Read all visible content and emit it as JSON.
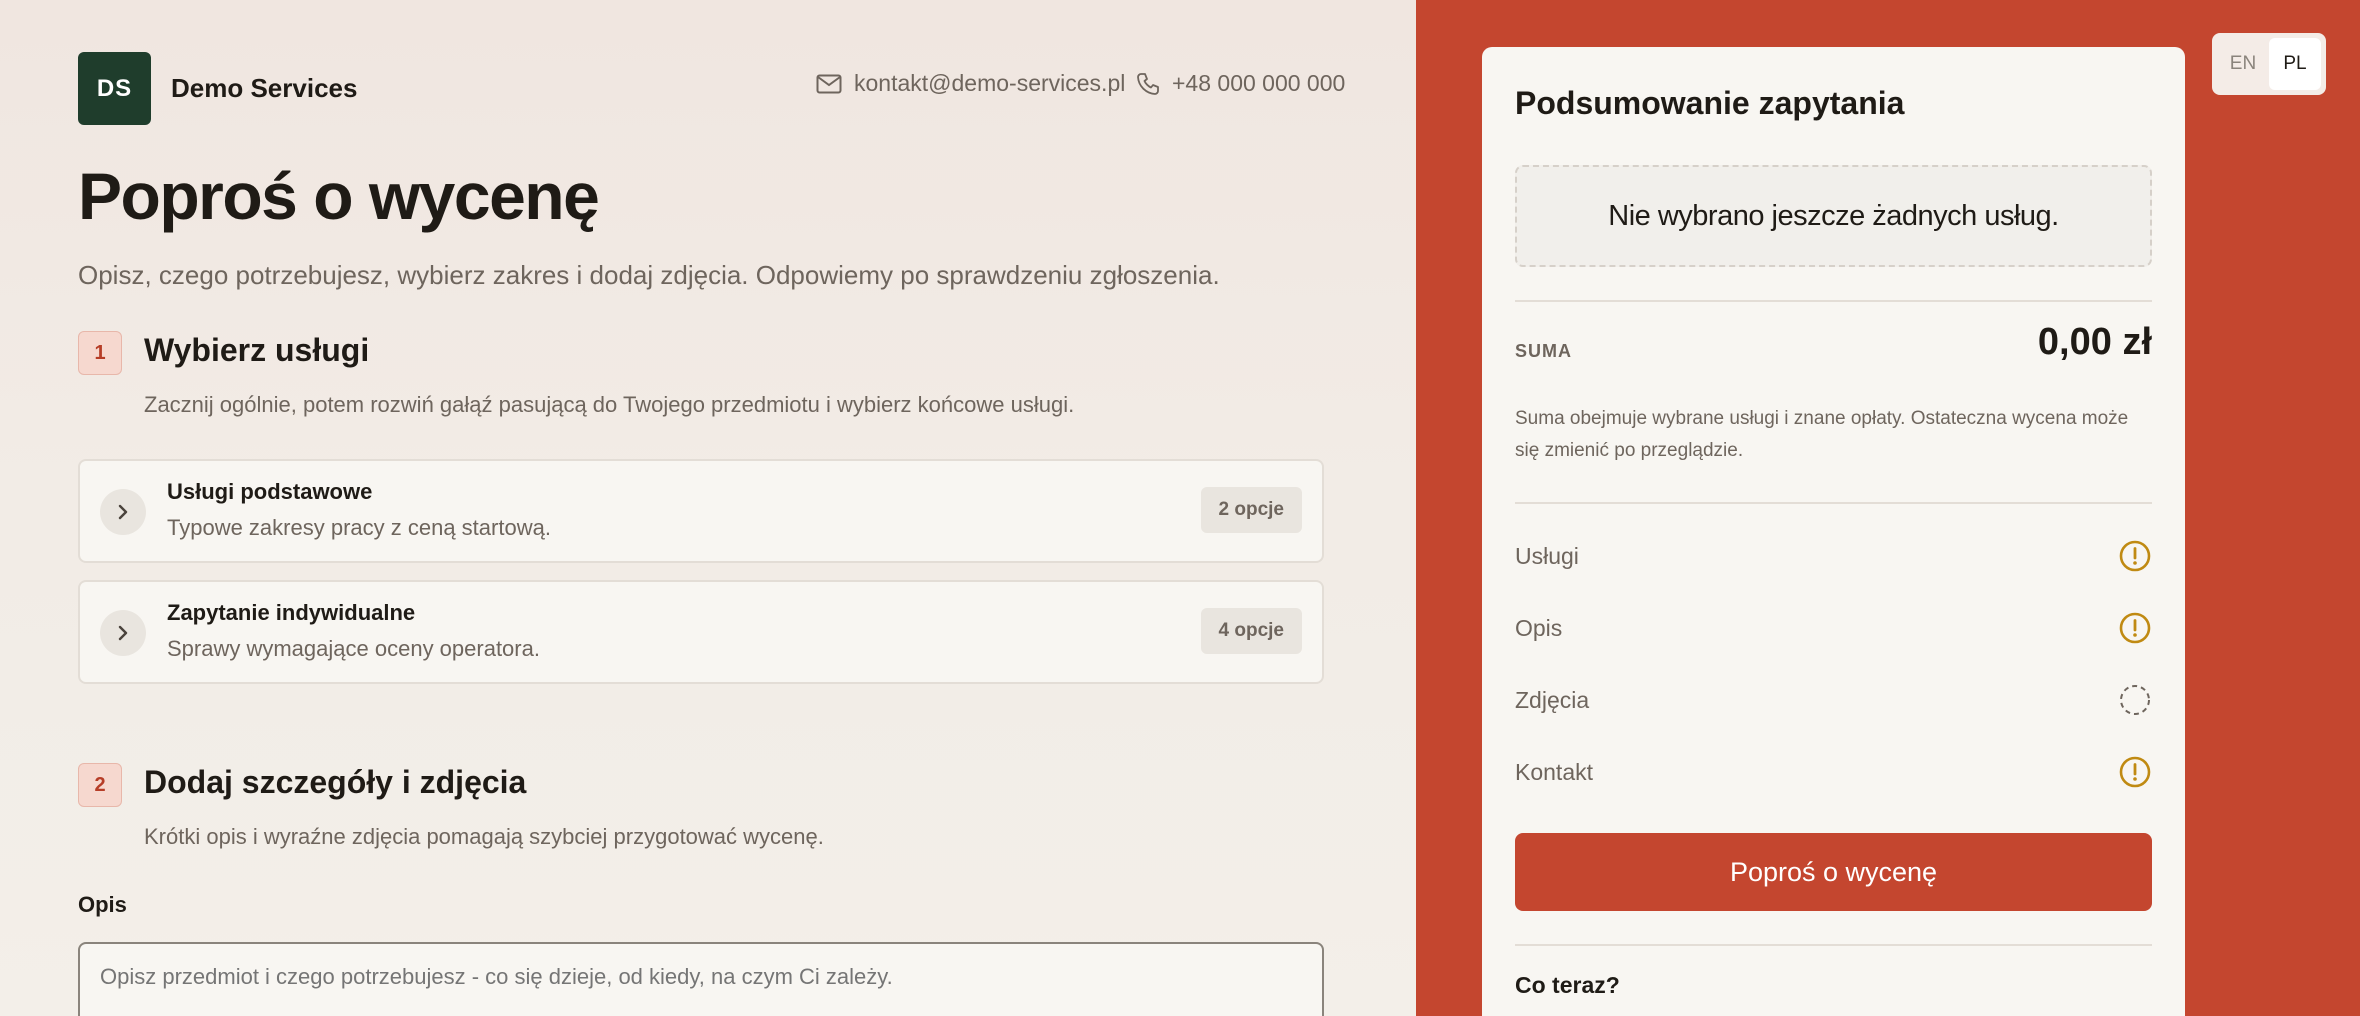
{
  "header": {
    "logo_text": "DS",
    "brand_name": "Demo Services",
    "email": "kontakt@demo-services.pl",
    "phone": "+48 000 000 000"
  },
  "page": {
    "title": "Poproś o wycenę",
    "lead": "Opisz, czego potrzebujesz, wybierz zakres i dodaj zdjęcia. Odpowiemy po sprawdzeniu zgłoszenia."
  },
  "step1": {
    "number": "1",
    "title": "Wybierz usługi",
    "subtitle": "Zacznij ogólnie, potem rozwiń gałąź pasującą do Twojego przedmiotu i wybierz końcowe usługi.",
    "cards": [
      {
        "title": "Usługi podstawowe",
        "subtitle": "Typowe zakresy pracy z ceną startową.",
        "badge": "2 opcje"
      },
      {
        "title": "Zapytanie indywidualne",
        "subtitle": "Sprawy wymagające oceny operatora.",
        "badge": "4 opcje"
      }
    ]
  },
  "step2": {
    "number": "2",
    "title": "Dodaj szczegóły i zdjęcia",
    "subtitle": "Krótki opis i wyraźne zdjęcia pomagają szybciej przygotować wycenę.",
    "description_label": "Opis",
    "description_placeholder": "Opisz przedmiot i czego potrzebujesz - co się dzieje, od kiedy, na czym Ci zależy."
  },
  "lang": {
    "options": [
      "EN",
      "PL"
    ],
    "active": "PL"
  },
  "summary": {
    "title": "Podsumowanie zapytania",
    "empty_text": "Nie wybrano jeszcze żadnych usług.",
    "sum_label": "SUMA",
    "sum_value": "0,00 zł",
    "note": "Suma obejmuje wybrane usługi i znane opłaty. Ostateczna wycena może się zmienić po przeglądzie.",
    "checks": [
      {
        "label": "Usługi",
        "status": "warning"
      },
      {
        "label": "Opis",
        "status": "warning"
      },
      {
        "label": "Zdjęcia",
        "status": "pending"
      },
      {
        "label": "Kontakt",
        "status": "warning"
      }
    ],
    "submit_label": "Poproś o wycenę",
    "next_title": "Co teraz?"
  },
  "colors": {
    "accent": "#c4462f",
    "logo_bg": "#1f3d2c",
    "warning": "#c08a12"
  }
}
